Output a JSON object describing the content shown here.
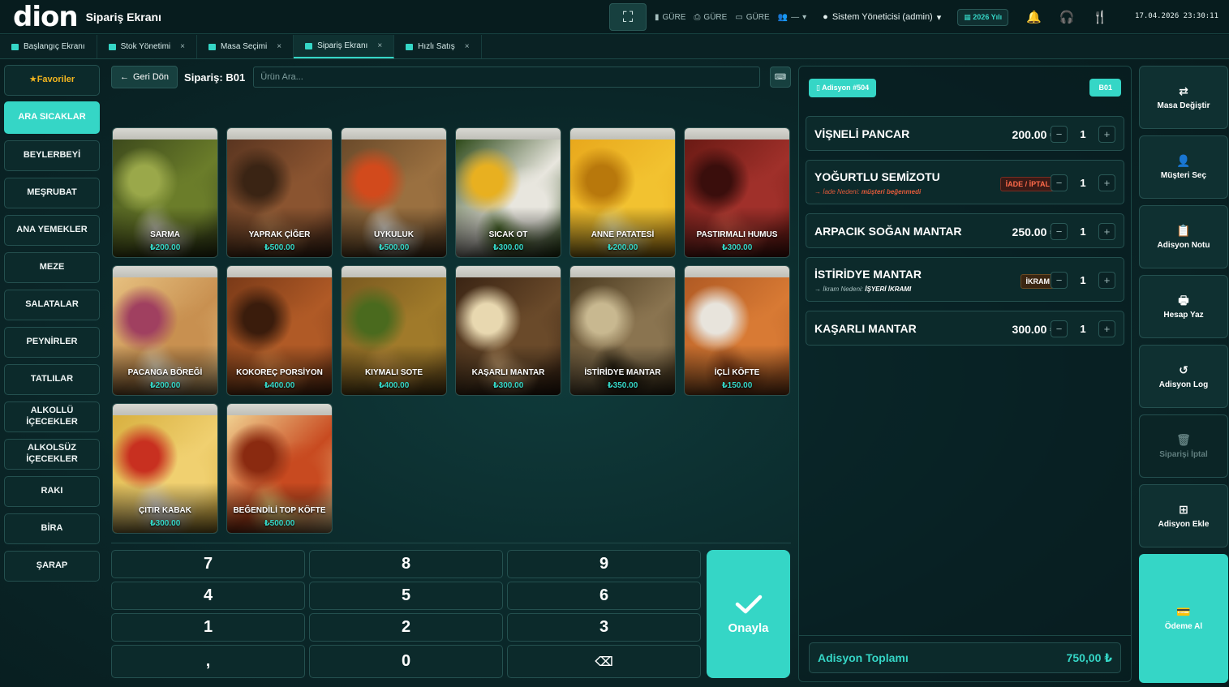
{
  "app": {
    "logo": "dion",
    "title": "Sipariş Ekranı"
  },
  "topbar": {
    "gure": [
      "GÜRE",
      "GÜRE",
      "GÜRE"
    ],
    "gure_tail": "—",
    "user": "Sistem Yöneticisi (admin)",
    "year": "2026 Yılı",
    "datetime": "17.04.2026 23:30:11"
  },
  "tabs": [
    {
      "label": "Başlangıç Ekranı",
      "closable": false
    },
    {
      "label": "Stok Yönetimi",
      "closable": true
    },
    {
      "label": "Masa Seçimi",
      "closable": true
    },
    {
      "label": "Sipariş Ekranı",
      "closable": true,
      "active": true
    },
    {
      "label": "Hızlı Satış",
      "closable": true
    }
  ],
  "categories": [
    {
      "label": "Favoriler",
      "star": "★"
    },
    {
      "label": "ARA SICAKLAR",
      "active": true
    },
    {
      "label": "BEYLERBEYİ"
    },
    {
      "label": "MEŞRUBAT"
    },
    {
      "label": "ANA YEMEKLER"
    },
    {
      "label": "MEZE"
    },
    {
      "label": "SALATALAR"
    },
    {
      "label": "PEYNİRLER"
    },
    {
      "label": "TATLILAR"
    },
    {
      "label": "ALKOLLÜ İÇECEKLER"
    },
    {
      "label": "ALKOLSÜZ İÇECEKLER"
    },
    {
      "label": "RAKI"
    },
    {
      "label": "BİRA"
    },
    {
      "label": "ŞARAP"
    }
  ],
  "subbar": {
    "back": "Geri Dön",
    "order_title": "Sipariş: B01",
    "search_placeholder": "Ürün Ara..."
  },
  "products": [
    {
      "name": "SARMA",
      "price": "₺200.00",
      "palette": [
        "#3d4a1c",
        "#6b7d2a",
        "#9aa84a",
        "#c9c9b8"
      ]
    },
    {
      "name": "YAPRAK ÇİĞER",
      "price": "₺500.00",
      "palette": [
        "#5a3520",
        "#8a5430",
        "#3a2414",
        "#b0784a"
      ]
    },
    {
      "name": "UYKULUK",
      "price": "₺500.00",
      "palette": [
        "#6a4a2a",
        "#9a7040",
        "#d24a1c",
        "#e8e2d8"
      ]
    },
    {
      "name": "SICAK OT",
      "price": "₺300.00",
      "palette": [
        "#2e4a1a",
        "#e8e6de",
        "#e8b020",
        "#4a6a2a"
      ]
    },
    {
      "name": "ANNE PATATESİ",
      "price": "₺200.00",
      "palette": [
        "#e8a81c",
        "#f2c230",
        "#b8780c",
        "#fff0a0"
      ]
    },
    {
      "name": "PASTIRMALI HUMUS",
      "price": "₺300.00",
      "palette": [
        "#6a1a14",
        "#a0302a",
        "#3a0e0c",
        "#d05040"
      ]
    },
    {
      "name": "PACANGA BÖREĞİ",
      "price": "₺200.00",
      "palette": [
        "#e6c080",
        "#c89050",
        "#a04060",
        "#f0e0c0"
      ]
    },
    {
      "name": "KOKOREÇ PORSİYON",
      "price": "₺400.00",
      "palette": [
        "#7a3a18",
        "#b05a26",
        "#3a1c0c",
        "#d88040"
      ]
    },
    {
      "name": "KIYMALI SOTE",
      "price": "₺400.00",
      "palette": [
        "#7a5a20",
        "#a07a2a",
        "#4a6a1e",
        "#c09040"
      ]
    },
    {
      "name": "KAŞARLI MANTAR",
      "price": "₺300.00",
      "palette": [
        "#3a2414",
        "#6a4a2a",
        "#e8d8b0",
        "#c8a070"
      ]
    },
    {
      "name": "İSTİRİDYE MANTAR",
      "price": "₺350.00",
      "palette": [
        "#4a3a20",
        "#8a7450",
        "#c8b890",
        "#2a2212"
      ]
    },
    {
      "name": "İÇLİ KÖFTE",
      "price": "₺150.00",
      "palette": [
        "#b05a24",
        "#d87a34",
        "#e8e4dc",
        "#8a4018"
      ]
    },
    {
      "name": "ÇITIR KABAK",
      "price": "₺300.00",
      "palette": [
        "#d8b040",
        "#f0d070",
        "#c83020",
        "#e8e0d0"
      ]
    },
    {
      "name": "BEĞENDİLİ TOP KÖFTE",
      "price": "₺500.00",
      "palette": [
        "#f0d090",
        "#c84a20",
        "#8a2a10",
        "#e8c070"
      ]
    }
  ],
  "numpad": {
    "keys": [
      "7",
      "8",
      "9",
      "4",
      "5",
      "6",
      "1",
      "2",
      "3",
      ",",
      "0",
      "⌫"
    ],
    "confirm": "Onayla"
  },
  "order": {
    "adisyon": "Adisyon #504",
    "table": "B01",
    "items": [
      {
        "name": "VİŞNELİ PANCAR",
        "price": "200.00 ₺",
        "qty": "1"
      },
      {
        "name": "YOĞURTLU SEMİZOTU",
        "badge": "İADE / İPTAL",
        "badge_type": "iade",
        "reason_label": "→ İade Nedeni:",
        "reason": "müşteri beğenmedi",
        "qty": "1"
      },
      {
        "name": "ARPACIK SOĞAN MANTAR",
        "price": "250.00 ₺",
        "qty": "1"
      },
      {
        "name": "İSTİRİDYE MANTAR",
        "badge": "İKRAM",
        "badge_type": "ikram",
        "reason_label": "→ İkram Nedeni:",
        "reason": "İŞYERİ İKRAMI",
        "qty": "1"
      },
      {
        "name": "KAŞARLI MANTAR",
        "price": "300.00 ₺",
        "qty": "1"
      }
    ],
    "total_label": "Adisyon Toplamı",
    "total_value": "750,00 ₺"
  },
  "actions": [
    {
      "label": "Masa Değiştir",
      "icon": "⇄"
    },
    {
      "label": "Müşteri Seç",
      "icon": "👤"
    },
    {
      "label": "Adisyon Notu",
      "icon": "📋"
    },
    {
      "label": "Hesap Yaz",
      "icon": "🖶"
    },
    {
      "label": "Adisyon Log",
      "icon": "↺"
    },
    {
      "label": "Siparişi İptal",
      "icon": "🗑",
      "disabled": true
    },
    {
      "label": "Adisyon Ekle",
      "icon": "⊞"
    },
    {
      "label": "Ödeme Al",
      "icon": "💳",
      "primary": true
    }
  ],
  "colors": {
    "accent": "#35d6c6",
    "bg": "#0a2527",
    "iade": "#ff6a4a",
    "favorite": "#f2b51f"
  }
}
